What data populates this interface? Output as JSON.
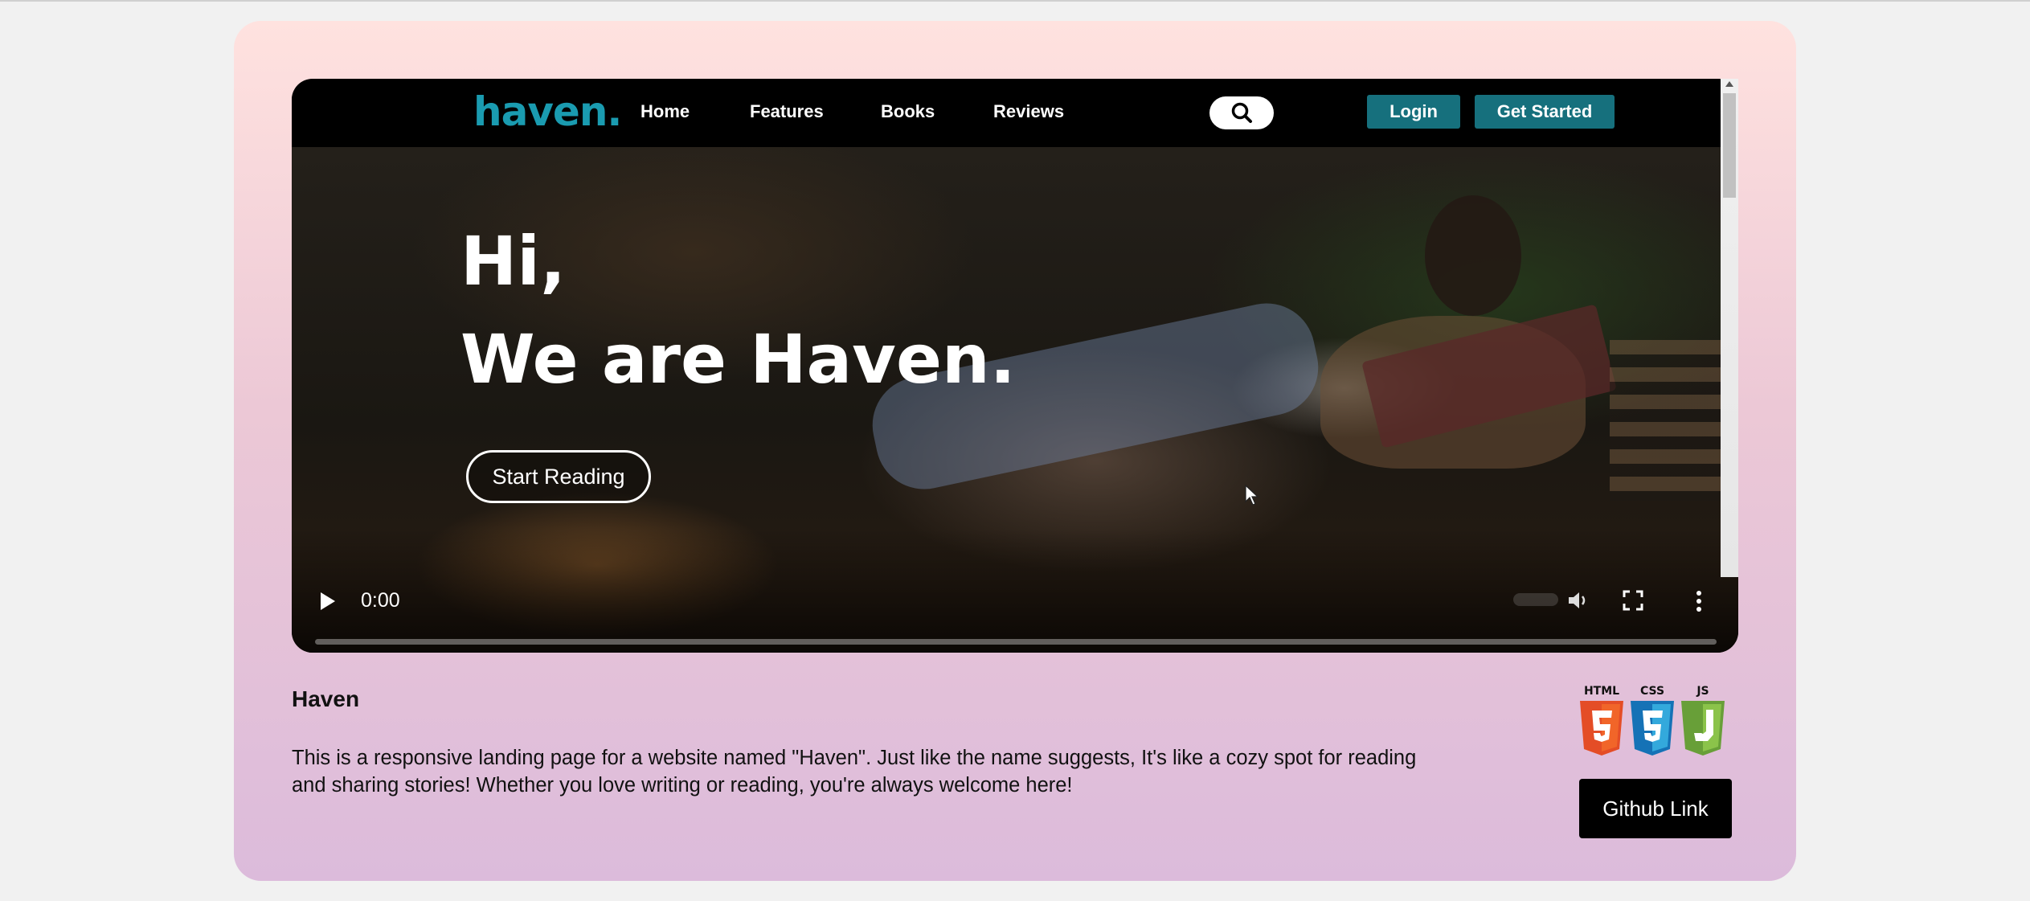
{
  "nav": {
    "logo": "haven.",
    "links": [
      "Home",
      "Features",
      "Books",
      "Reviews"
    ],
    "login_label": "Login",
    "get_started_label": "Get Started"
  },
  "hero": {
    "greeting": "Hi,",
    "headline": "We are Haven.",
    "cta_label": "Start Reading"
  },
  "video_controls": {
    "time": "0:00",
    "progress": 0
  },
  "project": {
    "title": "Haven",
    "description": "This is a responsive landing page for a website named \"Haven\". Just like the name suggests, It's like a cozy spot for reading and sharing stories! Whether you love writing or reading, you're always welcome here!",
    "badges": [
      "HTML",
      "CSS",
      "JS"
    ],
    "github_label": "Github Link"
  },
  "colors": {
    "brand_teal": "#16707d",
    "logo_teal": "#1a9bb0",
    "html_orange": "#e44d26",
    "css_blue": "#1f73c7",
    "js_green": "#7cb342"
  }
}
